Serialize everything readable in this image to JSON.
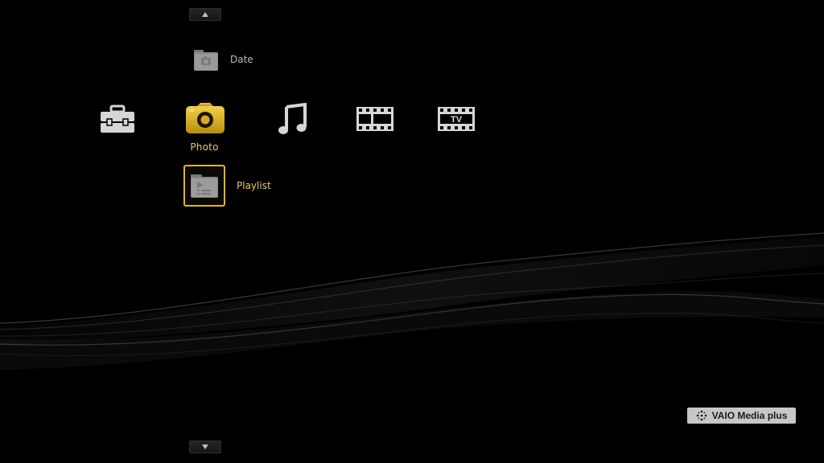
{
  "xmb": {
    "scroll_up_glyph": "▲",
    "scroll_down_glyph": "▼",
    "categories": [
      {
        "icon": "toolbox-icon",
        "label": ""
      },
      {
        "icon": "camera-icon",
        "label": "Photo"
      },
      {
        "icon": "music-note-icon",
        "label": ""
      },
      {
        "icon": "film-strip-icon",
        "label": ""
      },
      {
        "icon": "tv-film-icon",
        "label": "TV"
      }
    ],
    "selected_category_label": "Photo",
    "sub_items": [
      {
        "icon": "camera-folder-icon",
        "label": "Date"
      },
      {
        "icon": "playlist-folder-icon",
        "label": "Playlist"
      }
    ]
  },
  "brand": {
    "label": "VAIO Media plus"
  },
  "colors": {
    "background": "#000000",
    "accent_gold": "#e2b623",
    "selected_text": "#e8c86a",
    "icon_gray": "#c8c8c8",
    "badge_bg": "#c7c7c7"
  }
}
